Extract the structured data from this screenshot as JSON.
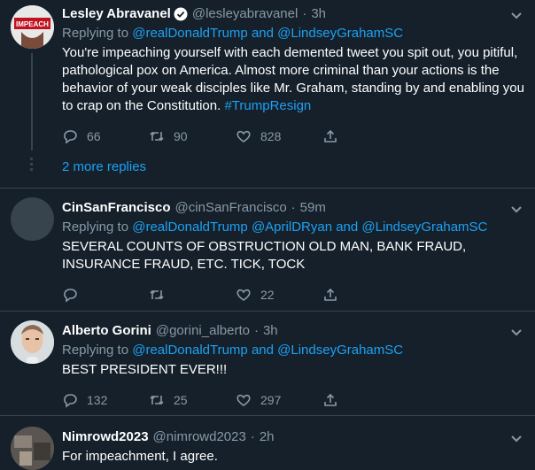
{
  "tweets": [
    {
      "name": "Lesley Abravanel",
      "handle": "@lesleyabravanel",
      "sep": "·",
      "time": "3h",
      "replying_prefix": "Replying to",
      "mention1": "@realDonaldTrump",
      "and": "and",
      "mention2": "@LindseyGrahamSC",
      "text": "You're impeaching yourself with each demented tweet you spit out, you pitiful, pathological pox on America. Almost more criminal than your actions is the behavior of your weak disciples like Mr. Graham, standing by and enabling you to crap on the Constitution.",
      "hashtag": "#TrumpResign",
      "replies": "66",
      "retweets": "90",
      "likes": "828",
      "avatar_text": "IMPEACH"
    },
    {
      "name": "CinSanFrancisco",
      "handle": "@cinSanFrancisco",
      "sep": "·",
      "time": "59m",
      "replying_prefix": "Replying to",
      "mention1": "@realDonaldTrump",
      "mention2": "@AprilDRyan",
      "and": "and",
      "mention3": "@LindseyGrahamSC",
      "text": "SEVERAL COUNTS OF OBSTRUCTION OLD MAN, BANK FRAUD, INSURANCE FRAUD, ETC.  TICK, TOCK",
      "likes": "22"
    },
    {
      "name": "Alberto Gorini",
      "handle": "@gorini_alberto",
      "sep": "·",
      "time": "3h",
      "replying_prefix": "Replying to",
      "mention1": "@realDonaldTrump",
      "and": "and",
      "mention2": "@LindseyGrahamSC",
      "text": "BEST PRESIDENT EVER!!!",
      "replies": "132",
      "retweets": "25",
      "likes": "297"
    },
    {
      "name": "Nimrowd2023",
      "handle": "@nimrowd2023",
      "sep": "·",
      "time": "2h",
      "text": "For impeachment,  I agree."
    }
  ],
  "more_replies": "2 more replies",
  "colors": {
    "background": "#15202b",
    "accent": "#1da1f2",
    "muted": "#8899a6",
    "divider": "#38444d"
  },
  "icons": [
    "verified-icon",
    "chevron-down-icon",
    "reply-icon",
    "retweet-icon",
    "like-icon",
    "share-icon"
  ]
}
